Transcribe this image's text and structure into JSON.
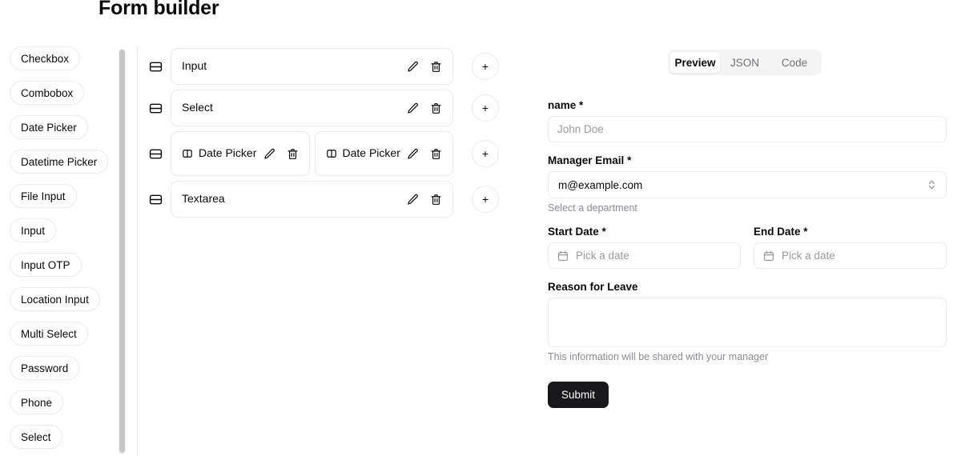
{
  "header": {
    "title": "Form builder"
  },
  "sidebar": {
    "items": [
      {
        "label": "Checkbox"
      },
      {
        "label": "Combobox"
      },
      {
        "label": "Date Picker"
      },
      {
        "label": "Datetime Picker"
      },
      {
        "label": "File Input"
      },
      {
        "label": "Input"
      },
      {
        "label": "Input OTP"
      },
      {
        "label": "Location Input"
      },
      {
        "label": "Multi Select"
      },
      {
        "label": "Password"
      },
      {
        "label": "Phone"
      },
      {
        "label": "Select"
      }
    ]
  },
  "canvas": {
    "add_label": "+",
    "rows": [
      {
        "fields": [
          {
            "label": "Input",
            "has_column_icon": false
          }
        ]
      },
      {
        "fields": [
          {
            "label": "Select",
            "has_column_icon": false
          }
        ]
      },
      {
        "fields": [
          {
            "label": "Date Picker",
            "has_column_icon": true
          },
          {
            "label": "Date Picker",
            "has_column_icon": true
          }
        ]
      },
      {
        "fields": [
          {
            "label": "Textarea",
            "has_column_icon": false
          }
        ]
      }
    ]
  },
  "preview": {
    "tabs": [
      {
        "label": "Preview",
        "active": true
      },
      {
        "label": "JSON",
        "active": false
      },
      {
        "label": "Code",
        "active": false
      }
    ],
    "form": {
      "name_label": "name",
      "name_required": "*",
      "name_placeholder": "John Doe",
      "name_value": "",
      "manager_label": "Manager Email",
      "manager_required": "*",
      "manager_value": "m@example.com",
      "manager_help": "Select a department",
      "start_label": "Start Date",
      "start_required": "*",
      "start_placeholder": "Pick a date",
      "end_label": "End Date",
      "end_required": "*",
      "end_placeholder": "Pick a date",
      "reason_label": "Reason for Leave",
      "reason_value": "",
      "reason_help": "This information will be shared with your manager",
      "submit_label": "Submit"
    }
  },
  "colors": {
    "border": "#ececec",
    "muted_text": "#8c8c92",
    "tab_bg": "#f4f4f5",
    "submit_bg": "#18181b",
    "scrollbar_thumb": "#c6c6c8"
  }
}
